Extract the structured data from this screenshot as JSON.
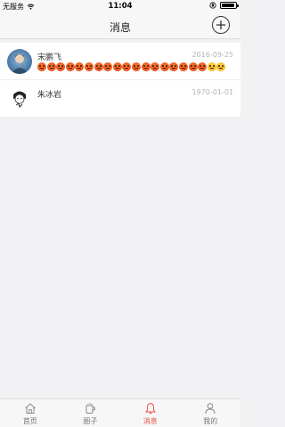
{
  "status_bar": {
    "carrier": "无服务",
    "time": "11:04",
    "battery_level": 0.9
  },
  "nav": {
    "title": "消息",
    "add_icon": "plus-circle-icon"
  },
  "conversations": [
    {
      "name": "宋鹏飞",
      "date": "2016-09-25",
      "avatar": "photo-avatar",
      "preview": "emoji-sequence"
    },
    {
      "name": "朱冰岩",
      "date": "1970-01-01",
      "avatar": "drawn-avatar",
      "preview": ""
    }
  ],
  "tabs": [
    {
      "label": "首页",
      "icon": "home-icon",
      "active": false
    },
    {
      "label": "圈子",
      "icon": "cup-icon",
      "active": false
    },
    {
      "label": "消息",
      "icon": "bell-icon",
      "active": true
    },
    {
      "label": "我的",
      "icon": "user-icon",
      "active": false
    }
  ],
  "colors": {
    "accent": "#e8534b",
    "background": "#f2f2f4",
    "date": "#b4b4b4"
  }
}
